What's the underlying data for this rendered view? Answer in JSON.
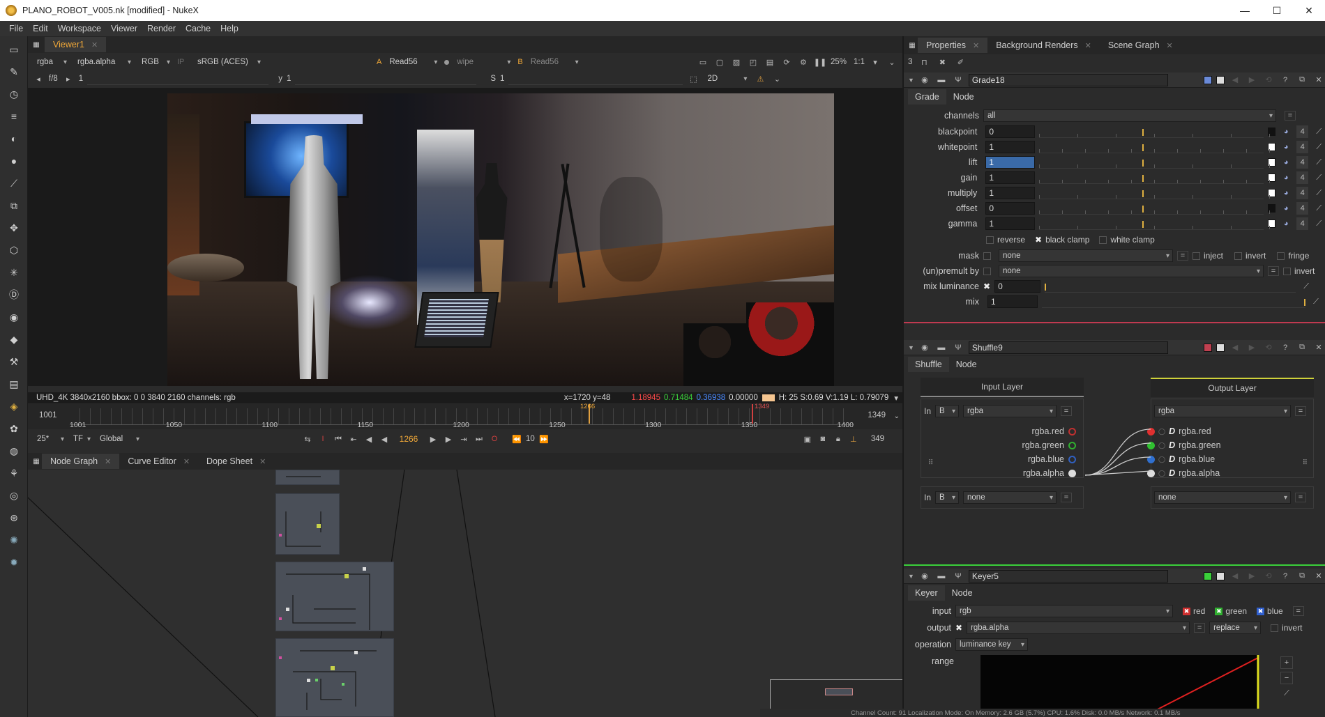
{
  "window": {
    "title": "PLANO_ROBOT_V005.nk [modified] - NukeX",
    "min": "—",
    "max": "☐",
    "close": "✕"
  },
  "menu": [
    "File",
    "Edit",
    "Workspace",
    "Viewer",
    "Render",
    "Cache",
    "Help"
  ],
  "viewer": {
    "tab": "Viewer1",
    "channels": "rgba",
    "channel_sel": "rgba.alpha",
    "display": "RGB",
    "ip": "IP",
    "lut": "sRGB (ACES)",
    "input_a_label": "A",
    "input_a": "Read56",
    "wipe": "wipe",
    "input_b_label": "B",
    "input_b": "Read56",
    "zoom": "25%",
    "ratio": "1:1",
    "fstop": "f/8",
    "frame_inc": "1",
    "y_label": "y",
    "y_val": "1",
    "s_label": "S",
    "s_val": "1",
    "mode": "2D",
    "ticks_top": [
      "-1",
      "-0.7",
      "-0.4",
      "0.1",
      "0.2",
      "5",
      "10",
      "15",
      "20",
      "25",
      "30"
    ],
    "info_left": "UHD_4K 3840x2160  bbox: 0 0 3840 2160 channels: rgb",
    "info_xy": "x=1720 y=48",
    "info_r": "1.18945",
    "info_g": "0.71484",
    "info_b": "0.36938",
    "info_a": "0.00000",
    "info_hsv": "H: 25 S:0.69 V:1.19  L: 0.79079"
  },
  "timeline": {
    "start": "1001",
    "end": "1349",
    "current": "1266",
    "marker": "1349",
    "out_count": "349",
    "labels": [
      "1001",
      "1050",
      "1100",
      "1150",
      "1200",
      "1250",
      "1300",
      "1350",
      "1400"
    ],
    "fps": "25*",
    "tf": "TF",
    "scope": "Global",
    "frame": "1266",
    "step": "10"
  },
  "panels": {
    "node_graph": "Node Graph",
    "curve_editor": "Curve Editor",
    "dope_sheet": "Dope Sheet"
  },
  "properties": {
    "tabs": [
      "Properties",
      "Background Renders",
      "Scene Graph"
    ],
    "count": "3",
    "grade": {
      "name": "Grade18",
      "tabs": [
        "Grade",
        "Node"
      ],
      "channels_label": "channels",
      "channels": "all",
      "params": [
        {
          "label": "blackpoint",
          "value": "0"
        },
        {
          "label": "whitepoint",
          "value": "1"
        },
        {
          "label": "lift",
          "value": "1"
        },
        {
          "label": "gain",
          "value": "1"
        },
        {
          "label": "multiply",
          "value": "1"
        },
        {
          "label": "offset",
          "value": "0"
        },
        {
          "label": "gamma",
          "value": "1"
        }
      ],
      "num4": "4",
      "reverse": "reverse",
      "black_clamp": "black clamp",
      "white_clamp": "white clamp",
      "mask_label": "mask",
      "mask": "none",
      "inject": "inject",
      "invert": "invert",
      "fringe": "fringe",
      "premult_label": "(un)premult by",
      "premult": "none",
      "invert2": "invert",
      "mixlum_label": "mix luminance",
      "mixlum": "0",
      "mix_label": "mix",
      "mix": "1",
      "ticks_a": [
        "-1",
        "-0.7",
        "-0.4",
        "-0.1",
        "0.2",
        "0.5",
        "0.8"
      ],
      "ticks_b": [
        "0",
        "0.1",
        "0.2",
        "0.3",
        "0.4",
        "0.5",
        "0.6",
        "0.7",
        "0.8",
        "0.9",
        "1"
      ]
    },
    "shuffle": {
      "name": "Shuffle9",
      "tabs": [
        "Shuffle",
        "Node"
      ],
      "input_layer": "Input Layer",
      "output_layer": "Output Layer",
      "in_label": "In",
      "in_b": "B",
      "in_layer": "rgba",
      "out_layer": "rgba",
      "channels_in": [
        "rgba.red",
        "rgba.green",
        "rgba.blue",
        "rgba.alpha"
      ],
      "channels_out": [
        "rgba.red",
        "rgba.green",
        "rgba.blue",
        "rgba.alpha"
      ],
      "in2_label": "In",
      "in2_b": "B",
      "in2_layer": "none",
      "out2_layer": "none"
    },
    "keyer": {
      "name": "Keyer5",
      "tabs": [
        "Keyer",
        "Node"
      ],
      "input_label": "input",
      "input": "rgb",
      "red": "red",
      "green": "green",
      "blue": "blue",
      "output_label": "output",
      "output": "rgba.alpha",
      "op_mode": "replace",
      "invert": "invert",
      "operation_label": "operation",
      "operation": "luminance key",
      "range_label": "range"
    }
  },
  "status": "Channel Count: 91  Localization Mode: On  Memory: 2.6 GB (5.7%)  CPU: 1.6%  Disk: 0.0 MB/s  Network: 0.1 MB/s"
}
